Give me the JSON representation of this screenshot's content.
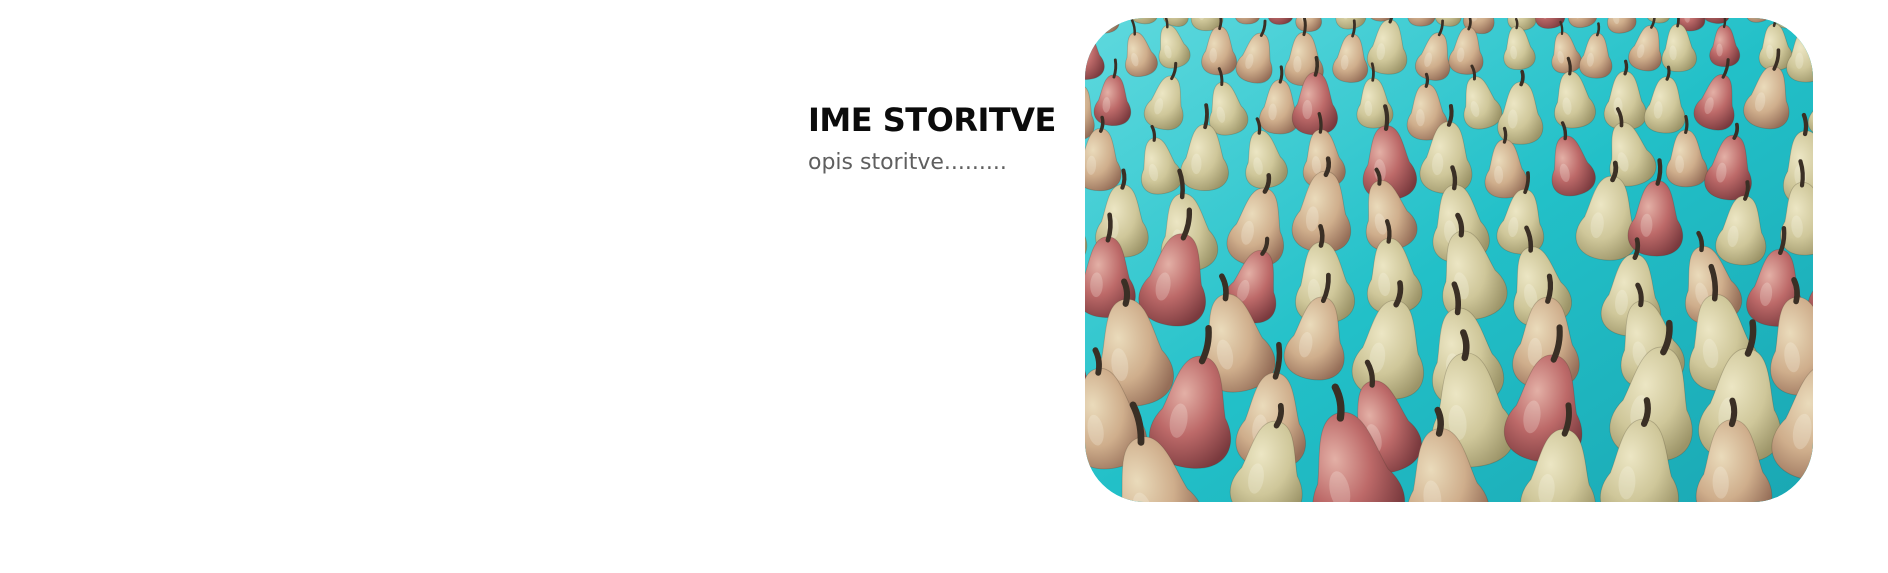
{
  "service": {
    "title": "IME STORITVE",
    "description": "opis storitve........."
  },
  "image": {
    "subject": "pears-photo",
    "colors": {
      "background_cloth": "#27c8cf",
      "pear_green": "#cfc99a",
      "pear_red": "#b85a5c",
      "stem": "#3a2f25"
    }
  }
}
